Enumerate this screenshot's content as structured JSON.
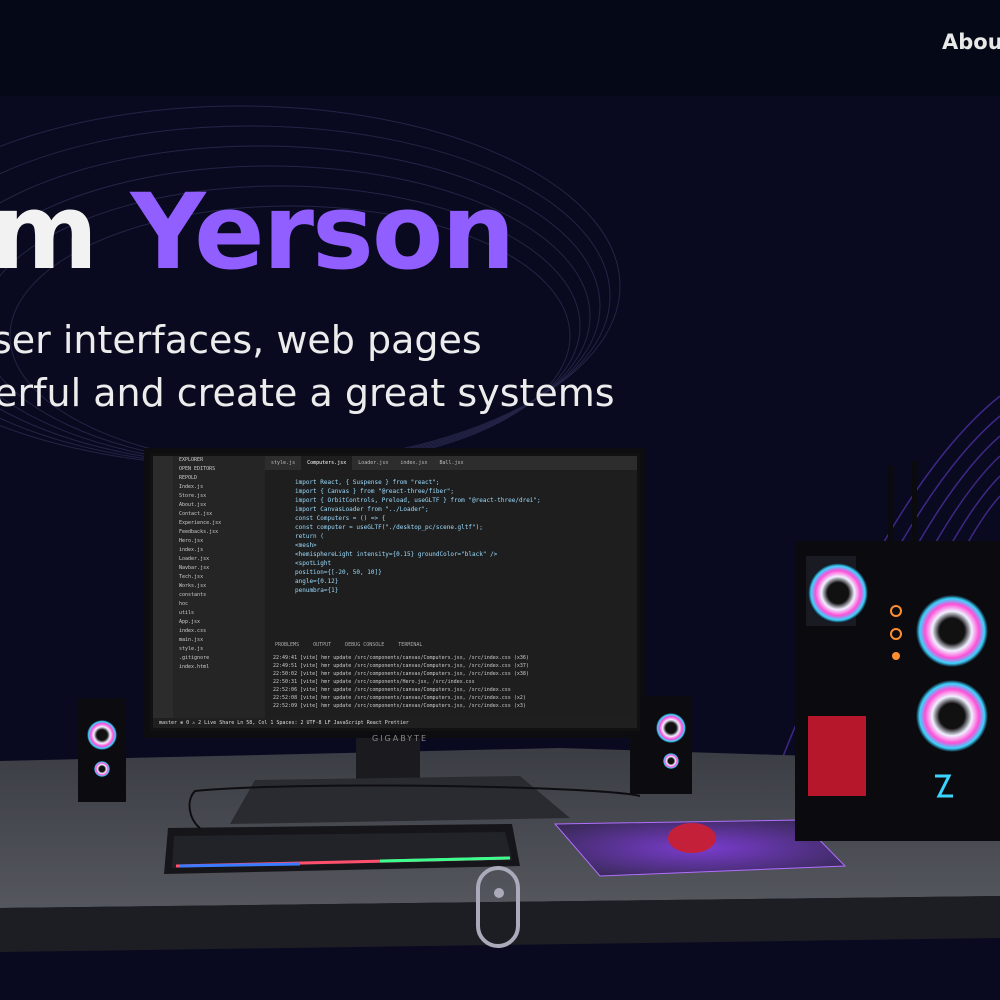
{
  "nav": {
    "about_label": "Abou"
  },
  "hero": {
    "headline_prefix": "'m ",
    "headline_name": "Yerson",
    "subtitle_line1": "ser interfaces, web pages",
    "subtitle_line2": "derful and create a great systems"
  },
  "scene": {
    "monitor_brand": "GIGABYTE",
    "editor": {
      "sidebar_items": [
        "EXPLORER",
        "OPEN EDITORS",
        "REPOLD",
        "Index.js",
        "Store.jsx",
        "About.jsx",
        "Contact.jsx",
        "Experience.jsx",
        "Feedbacks.jsx",
        "Hero.jsx",
        "index.js",
        "Loader.jsx",
        "Navbar.jsx",
        "Tech.jsx",
        "Works.jsx",
        "constants",
        "hoc",
        "utils",
        "App.jsx",
        "index.css",
        "main.jsx",
        "style.js",
        ".gitignore",
        "index.html"
      ],
      "tabs": [
        "style.js",
        "Computers.jsx",
        "Loader.jsx",
        "index.jsx",
        "Ball.jsx"
      ],
      "active_tab": "Computers.jsx",
      "code_lines": [
        "import React, { Suspense } from \"react\";",
        "import { Canvas } from \"@react-three/fiber\";",
        "import { OrbitControls, Preload, useGLTF } from \"@react-three/drei\";",
        "",
        "import CanvasLoader from \"../Loader\";",
        "",
        "const Computers = () => {",
        "  const computer = useGLTF(\"./desktop_pc/scene.gltf\");",
        "",
        "  return (",
        "    <mesh>",
        "      <hemisphereLight intensity={0.15} groundColor=\"black\" />",
        "      <spotLight",
        "        position={[-20, 50, 10]}",
        "        angle={0.12}",
        "        penumbra={1}"
      ],
      "terminal_tabs": [
        "PROBLEMS",
        "OUTPUT",
        "DEBUG CONSOLE",
        "TERMINAL"
      ],
      "terminal_lines": [
        "22:49:41 [vite] hmr update /src/components/canvas/Computers.jsx, /src/index.css (x36)",
        "22:49:51 [vite] hmr update /src/components/canvas/Computers.jsx, /src/index.css (x37)",
        "22:50:02 [vite] hmr update /src/components/canvas/Computers.jsx, /src/index.css (x38)",
        "22:50:31 [vite] hmr update /src/components/Hero.jsx, /src/index.css",
        "22:52:06 [vite] hmr update /src/components/canvas/Computers.jsx, /src/index.css",
        "22:52:08 [vite] hmr update /src/components/canvas/Computers.jsx, /src/index.css (x2)",
        "22:52:09 [vite] hmr update /src/components/canvas/Computers.jsx, /src/index.css (x3)"
      ],
      "status_bar": "master  ⊗ 0 ⚠ 2   Live Share     Ln 58, Col 1   Spaces: 2   UTF-8   LF   JavaScript React   Prettier"
    }
  },
  "colors": {
    "accent": "#915eff",
    "background": "#050816"
  }
}
